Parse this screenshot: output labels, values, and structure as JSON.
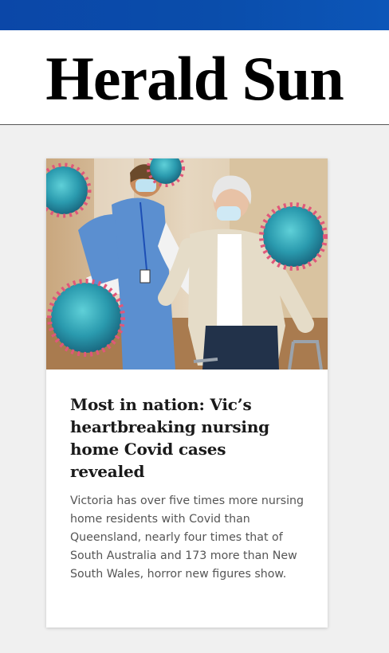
{
  "masthead": {
    "logo_text": "Herald Sun"
  },
  "colors": {
    "top_bar": "#0b47a8",
    "page_background": "#f0f0f0",
    "card_background": "#ffffff"
  },
  "article": {
    "headline": "Most in nation: Vic’s heartbreaking nursing home Covid cases revealed",
    "summary": "Victoria has over five times more nursing home residents with Covid than Queensland, nearly four times that of South Australia and 173 more than New South Wales, horror new figures show."
  }
}
